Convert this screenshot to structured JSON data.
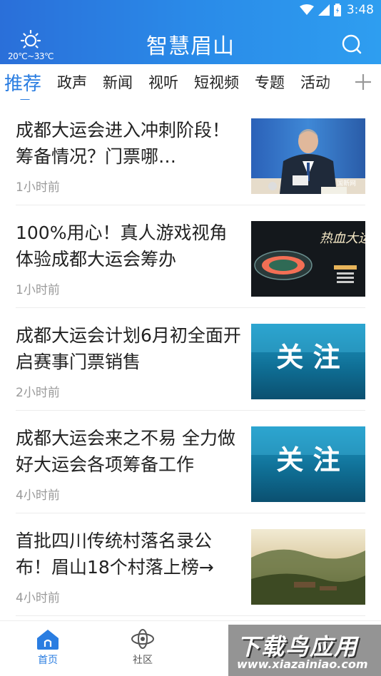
{
  "status": {
    "time": "3:48"
  },
  "header": {
    "title": "智慧眉山",
    "weather_temp": "20℃~33℃"
  },
  "tabs": [
    "推荐",
    "政声",
    "新闻",
    "视听",
    "短视频",
    "专题",
    "活动"
  ],
  "news": [
    {
      "title": "成都大运会进入冲刺阶段！筹备情况？门票哪…",
      "time": "1小时前",
      "thumb_caption": "国新网"
    },
    {
      "title": "100%用心！真人游戏视角体验成都大运会筹办",
      "time": "1小时前",
      "thumb_caption": "热血大运"
    },
    {
      "title": "成都大运会计划6月初全面开启赛事门票销售",
      "time": "2小时前",
      "thumb_caption": "关 注"
    },
    {
      "title": "成都大运会来之不易 全力做好大运会各项筹备工作",
      "time": "4小时前",
      "thumb_caption": "关 注"
    },
    {
      "title": "首批四川传统村落名录公布！眉山18个村落上榜→",
      "time": "4小时前",
      "thumb_caption": ""
    }
  ],
  "bottom_nav": {
    "home": "首页",
    "community": "社区"
  },
  "watermark": {
    "title": "下载鸟应用",
    "url": "www.xiazainiao.com"
  },
  "colors": {
    "accent": "#2a7de1",
    "header_start": "#2a6fd9",
    "header_end": "#2e9ef0"
  }
}
